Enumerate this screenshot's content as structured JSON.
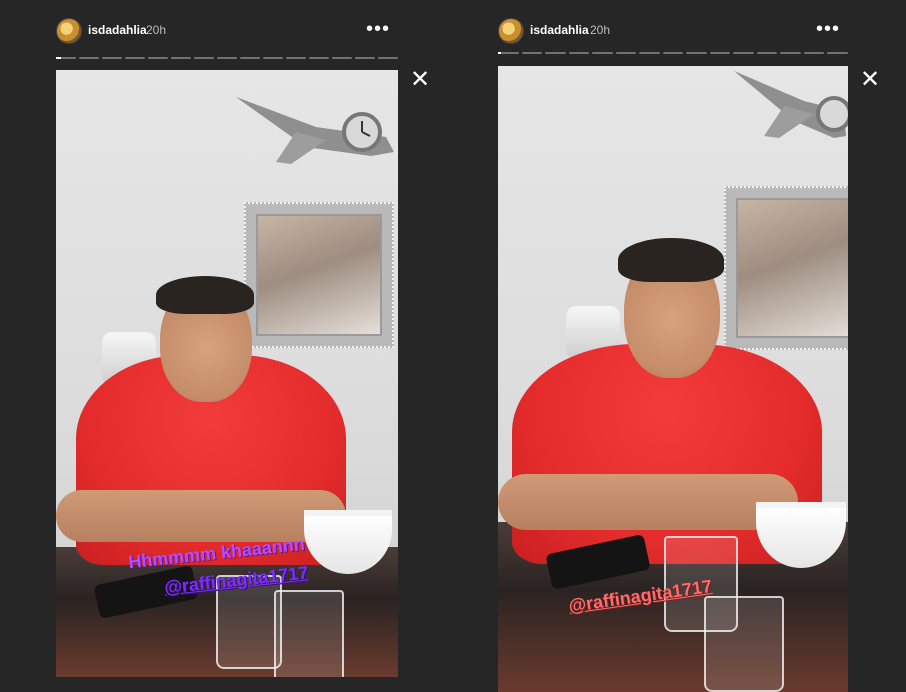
{
  "stories": [
    {
      "username": "isdadahlia",
      "time": "20h",
      "more_label": "•••",
      "segments_total": 15,
      "active_segment_fill": 0.25,
      "caption_line1": "Hhmmmm khaaannn",
      "mention": "@raffinagita1717",
      "close_label": "✕",
      "colors": {
        "caption": "#b44cff",
        "mention": "#7b2cff"
      }
    },
    {
      "username": "isdadahlia",
      "time": "20h",
      "more_label": "•••",
      "segments_total": 15,
      "active_segment_fill": 0.15,
      "mention": "@raffinagita1717",
      "close_label": "✕",
      "colors": {
        "mention": "#ff6b6b"
      }
    }
  ]
}
